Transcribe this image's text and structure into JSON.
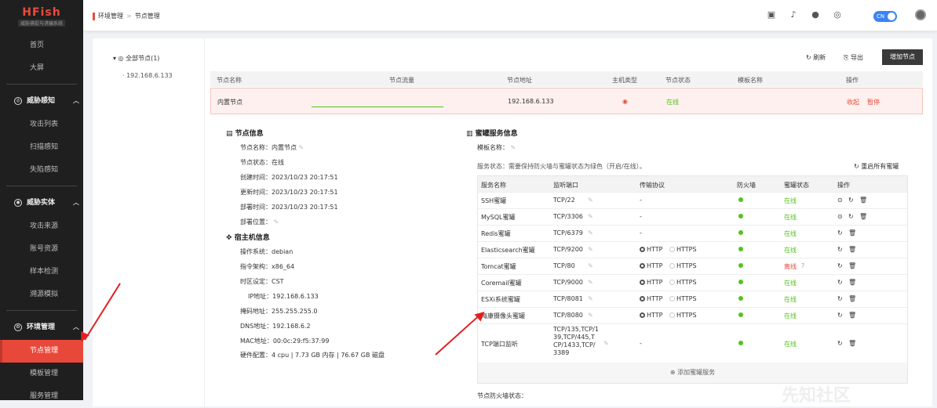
{
  "app": {
    "name": "HFish",
    "subtitle": "威胁捕捉与诱骗系统"
  },
  "sidebar": {
    "top": [
      "首页",
      "大屏"
    ],
    "groups": [
      {
        "label": "威胁感知",
        "items": [
          "攻击列表",
          "扫描感知",
          "失陷感知"
        ]
      },
      {
        "label": "威胁实体",
        "items": [
          "攻击来源",
          "账号资源",
          "样本检测",
          "溯源模拟"
        ]
      },
      {
        "label": "环境管理",
        "items": [
          "节点管理",
          "模板管理",
          "服务管理"
        ]
      }
    ]
  },
  "breadcrumb": {
    "parent": "环境管理",
    "current": "节点管理"
  },
  "topbar": {
    "lang": "CN"
  },
  "tree": {
    "root": "全部节点(1)",
    "child": "192.168.6.133"
  },
  "toolbar": {
    "refresh": "刷新",
    "export": "导出",
    "add": "增加节点"
  },
  "nodetable": {
    "headers": [
      "节点名称",
      "节点流量",
      "节点地址",
      "主机类型",
      "节点状态",
      "模板名称",
      "操作"
    ],
    "row": {
      "name": "内置节点",
      "address": "192.168.6.133",
      "status": "在线",
      "collapse": "收起",
      "pause": "暂停"
    }
  },
  "nodeinfo": {
    "title": "节点信息",
    "name": "节点名称：内置节点",
    "status": "节点状态：在线",
    "created": "创建时间：2023/10/23 20:17:51",
    "updated": "更新时间：2023/10/23 20:17:51",
    "deployed": "部署时间：2023/10/23 20:17:51",
    "location": "部署位置："
  },
  "hostinfo": {
    "title": "宿主机信息",
    "os": "操作系统：debian",
    "arch": "指令架构：x86_64",
    "tz": "时区设定：CST",
    "ip": "IP地址：192.168.6.133",
    "mask": "掩码地址：255.255.255.0",
    "dns": "DNS地址：192.168.6.2",
    "mac": "MAC地址：00:0c:29:f5:37:99",
    "hw": "硬件配置：4 cpu | 7.73 GB 内存 | 76.67 GB 磁盘"
  },
  "honeypot": {
    "title": "蜜罐服务信息",
    "template": "模板名称：",
    "status_note": "服务状态：需要保持防火墙与蜜罐状态为绿色（开启/在线）。",
    "restart": "重启所有蜜罐",
    "headers": [
      "服务名称",
      "监听端口",
      "传输协议",
      "防火墙",
      "蜜罐状态",
      "操作"
    ],
    "rows": [
      {
        "name": "SSH蜜罐",
        "port": "TCP/22",
        "proto": "-",
        "state": "在线"
      },
      {
        "name": "MySQL蜜罐",
        "port": "TCP/3306",
        "proto": "-",
        "state": "在线"
      },
      {
        "name": "Redis蜜罐",
        "port": "TCP/6379",
        "proto": "-",
        "state": "在线"
      },
      {
        "name": "Elasticsearch蜜罐",
        "port": "TCP/9200",
        "proto": "HTTP HTTPS",
        "state": "在线"
      },
      {
        "name": "Tomcat蜜罐",
        "port": "TCP/80",
        "proto": "HTTP HTTPS",
        "state": "离线"
      },
      {
        "name": "Coremail蜜罐",
        "port": "TCP/9000",
        "proto": "HTTP HTTPS",
        "state": "在线"
      },
      {
        "name": "ESXi系统蜜罐",
        "port": "TCP/8081",
        "proto": "HTTP HTTPS",
        "state": "在线"
      },
      {
        "name": "海康摄像头蜜罐",
        "port": "TCP/8080",
        "proto": "HTTP HTTPS",
        "state": "在线"
      },
      {
        "name": "TCP端口监听",
        "port": "TCP/135,TCP/139,TCP/445,TCP/1433,TCP/3389",
        "proto": "-",
        "state": "在线"
      }
    ],
    "http": "HTTP",
    "https": "HTTPS",
    "add": "添加蜜罐服务",
    "firewall_state": "节点防火墙状态："
  },
  "watermark": "先知社区"
}
